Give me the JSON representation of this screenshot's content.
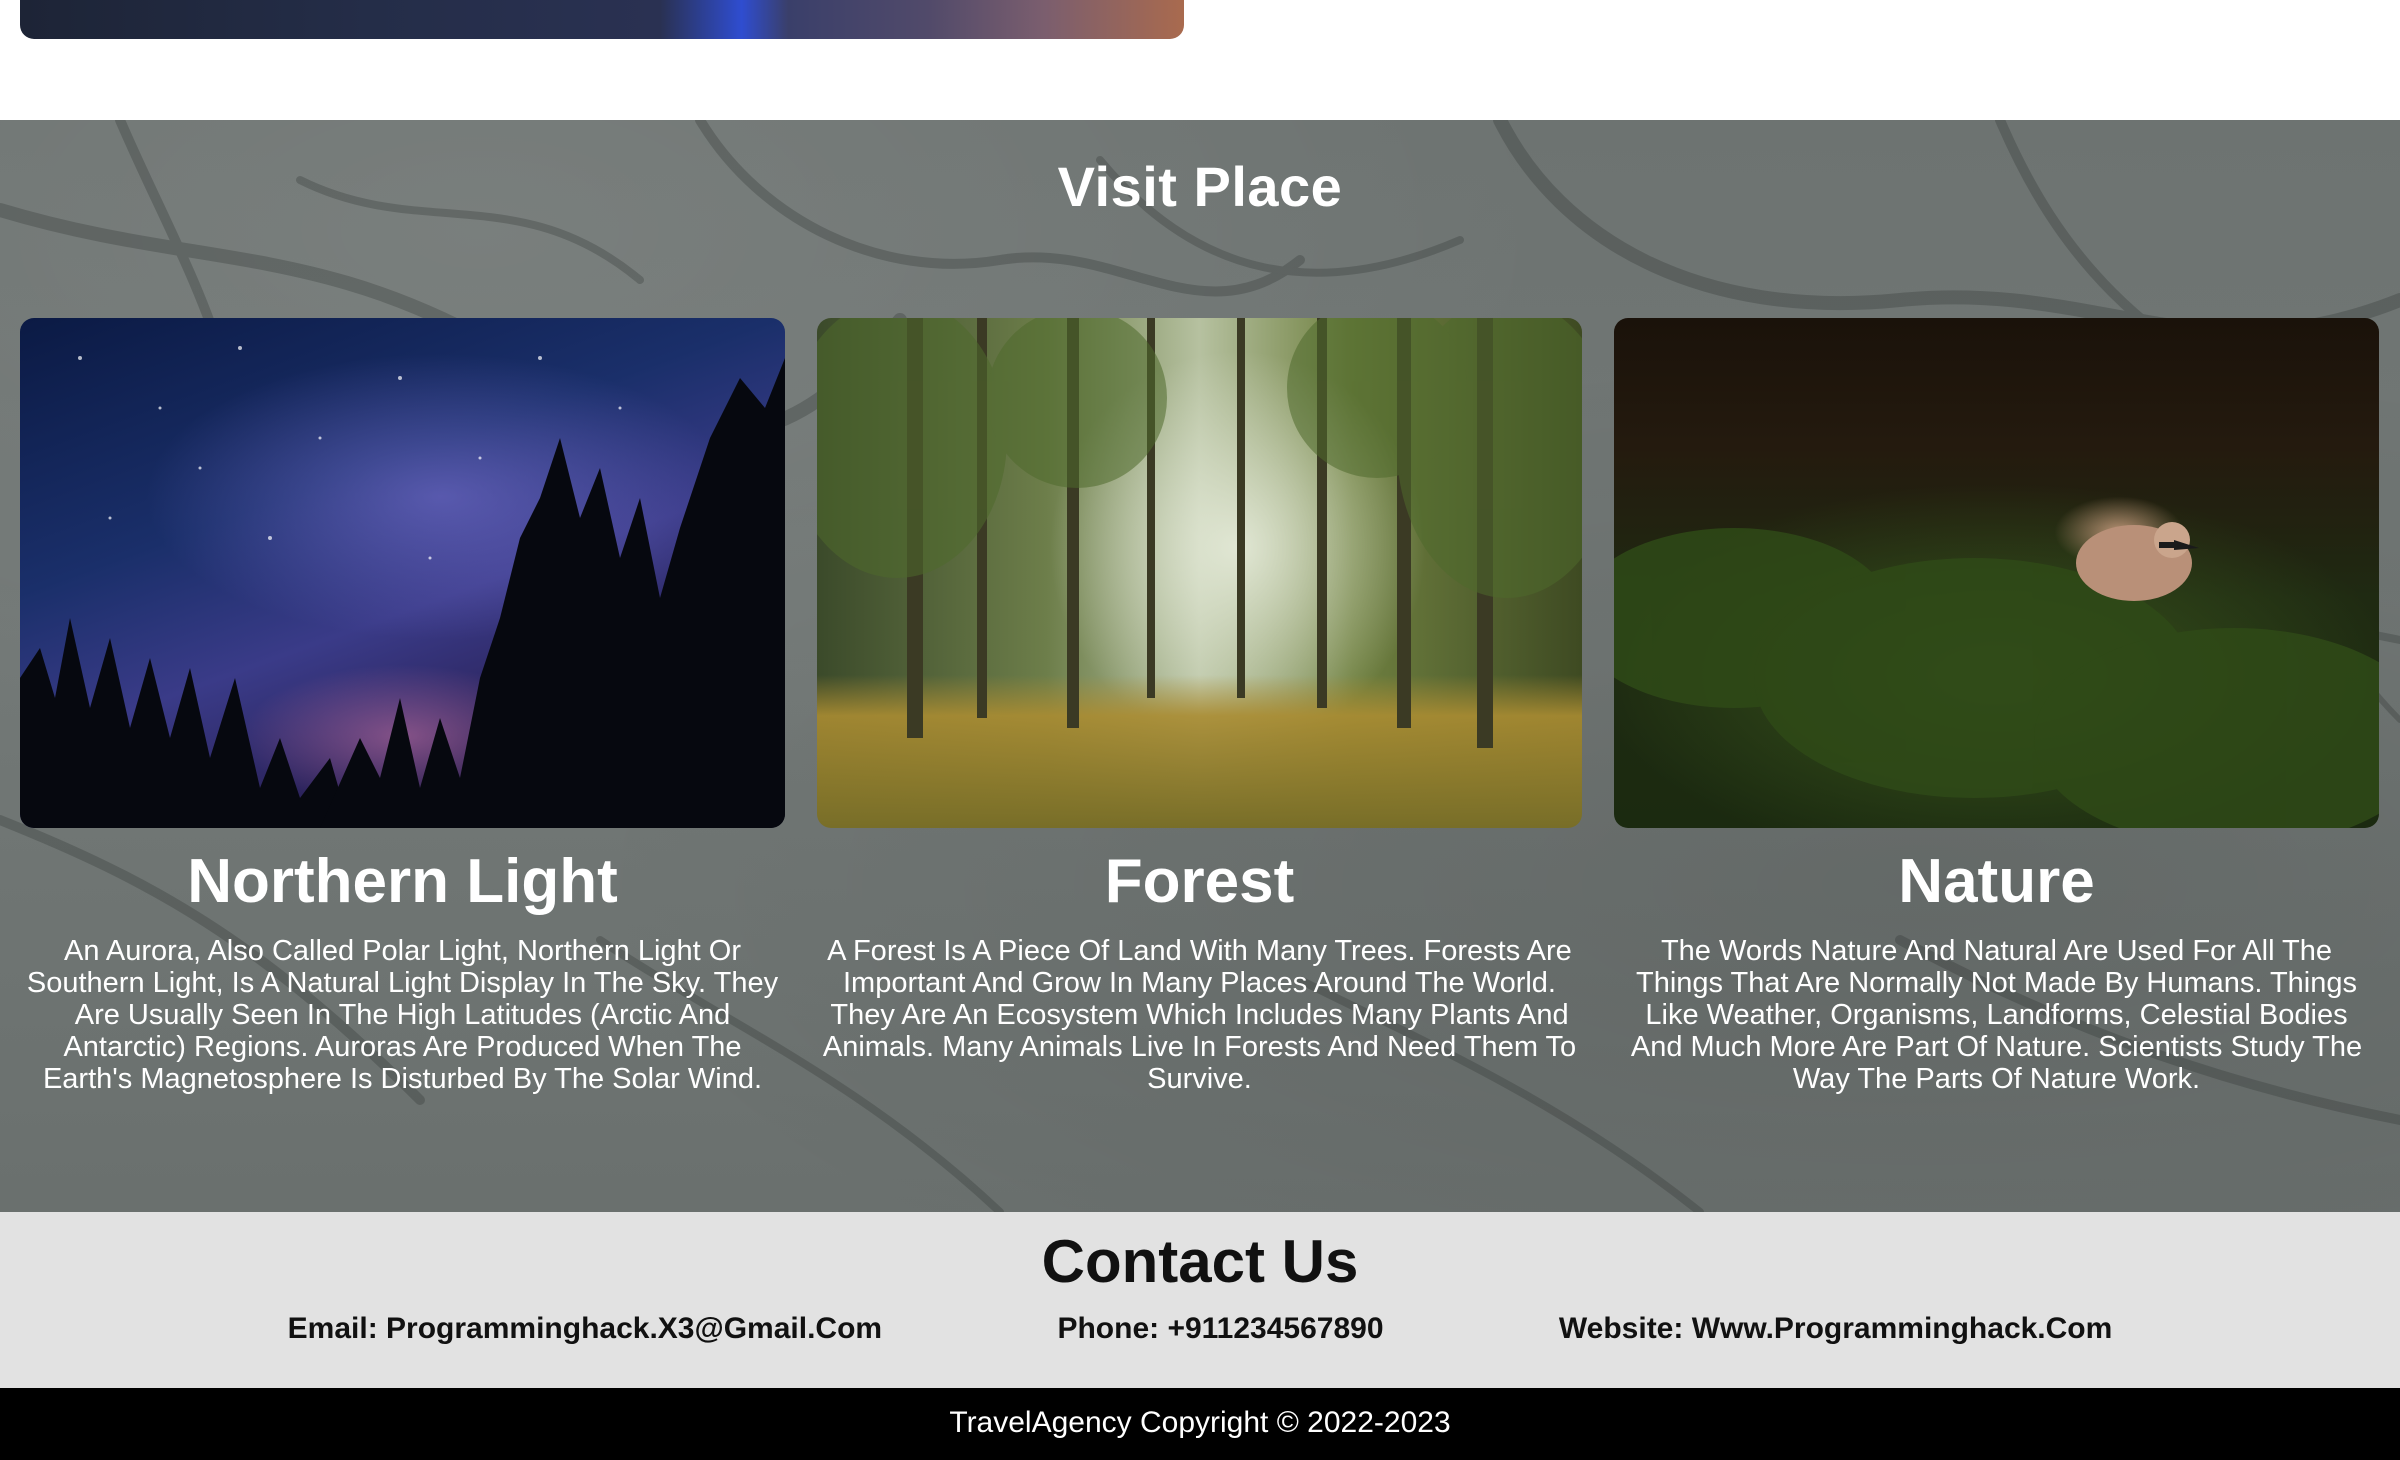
{
  "visit": {
    "title": "Visit Place",
    "cards": [
      {
        "title": "Northern Light",
        "text": "An Aurora, Also Called Polar Light, Northern Light Or Southern Light, Is A Natural Light Display In The Sky. They Are Usually Seen In The High Latitudes (Arctic And Antarctic) Regions. Auroras Are Produced When The Earth's Magnetosphere Is Disturbed By The Solar Wind."
      },
      {
        "title": "Forest",
        "text": "A Forest Is A Piece Of Land With Many Trees. Forests Are Important And Grow In Many Places Around The World. They Are An Ecosystem Which Includes Many Plants And Animals. Many Animals Live In Forests And Need Them To Survive."
      },
      {
        "title": "Nature",
        "text": "The Words Nature And Natural Are Used For All The Things That Are Normally Not Made By Humans. Things Like Weather, Organisms, Landforms, Celestial Bodies And Much More Are Part Of Nature. Scientists Study The Way The Parts Of Nature Work."
      }
    ]
  },
  "contact": {
    "title": "Contact Us",
    "email": "Email: Programminghack.X3@Gmail.Com",
    "phone": "Phone: +911234567890",
    "website": "Website: Www.Programminghack.Com"
  },
  "footer": {
    "text": "TravelAgency Copyright © 2022-2023"
  }
}
